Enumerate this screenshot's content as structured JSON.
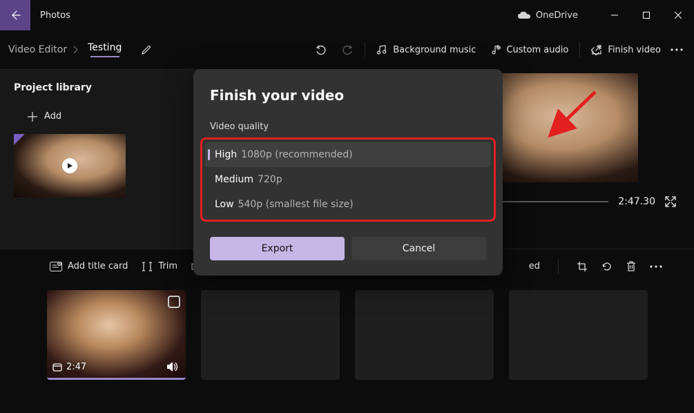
{
  "titlebar": {
    "app_name": "Photos",
    "onedrive_label": "OneDrive"
  },
  "toolbar": {
    "breadcrumb_root": "Video Editor",
    "project_name": "Testing",
    "background_music": "Background music",
    "custom_audio": "Custom audio",
    "finish_video": "Finish video"
  },
  "library": {
    "title": "Project library",
    "add_label": "Add"
  },
  "preview": {
    "time": "2:47.30"
  },
  "lowerbar": {
    "add_title_card": "Add title card",
    "trim": "Trim",
    "speed_end": "ed"
  },
  "clip": {
    "duration": "2:47"
  },
  "dialog": {
    "title": "Finish your video",
    "subtitle": "Video quality",
    "options": [
      {
        "name": "High",
        "detail": "1080p (recommended)"
      },
      {
        "name": "Medium",
        "detail": "720p"
      },
      {
        "name": "Low",
        "detail": "540p (smallest file size)"
      }
    ],
    "export": "Export",
    "cancel": "Cancel"
  }
}
